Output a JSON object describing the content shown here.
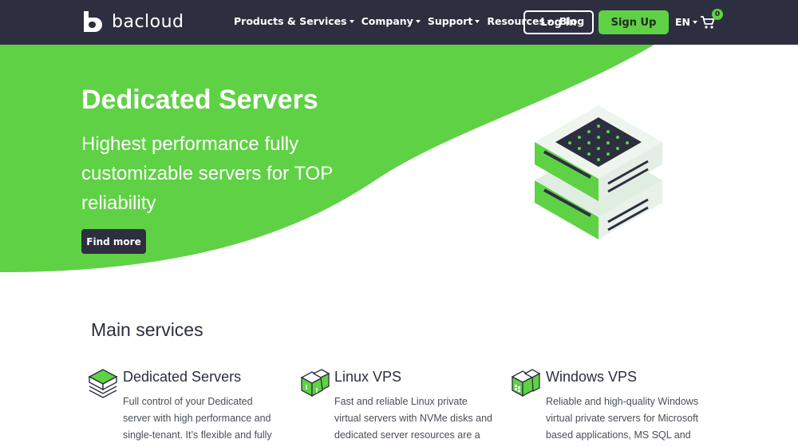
{
  "brand": {
    "name": "bacloud"
  },
  "nav": {
    "items": [
      {
        "label": "Products & Services",
        "has_dropdown": true
      },
      {
        "label": "Company",
        "has_dropdown": true
      },
      {
        "label": "Support",
        "has_dropdown": true
      },
      {
        "label": "Resources",
        "has_dropdown": true
      },
      {
        "label": "Blog",
        "has_dropdown": false
      }
    ],
    "login_label": "Log In",
    "signup_label": "Sign Up",
    "language": "EN",
    "cart_count": "0"
  },
  "hero": {
    "title": "Dedicated Servers",
    "subtitle": "Highest performance fully customizable servers for TOP reliability",
    "cta_label": "Find more"
  },
  "services": {
    "title": "Main services",
    "items": [
      {
        "title": "Dedicated Servers",
        "icon": "dedicated-server-icon",
        "description": "Full control of your Dedicated server with high performance and single-tenant. It’s flexible and fully"
      },
      {
        "title": "Linux VPS",
        "icon": "linux-vps-icon",
        "description": "Fast and reliable Linux private virtual servers with NVMe disks and dedicated server resources are a"
      },
      {
        "title": "Windows VPS",
        "icon": "windows-vps-icon",
        "description": "Reliable and high-quality Windows virtual private servers for Microsoft based applications, MS SQL and"
      }
    ]
  },
  "colors": {
    "header_bg": "#2d2f40",
    "accent_green": "#5fd145",
    "text_dark": "#2b2e3f"
  }
}
